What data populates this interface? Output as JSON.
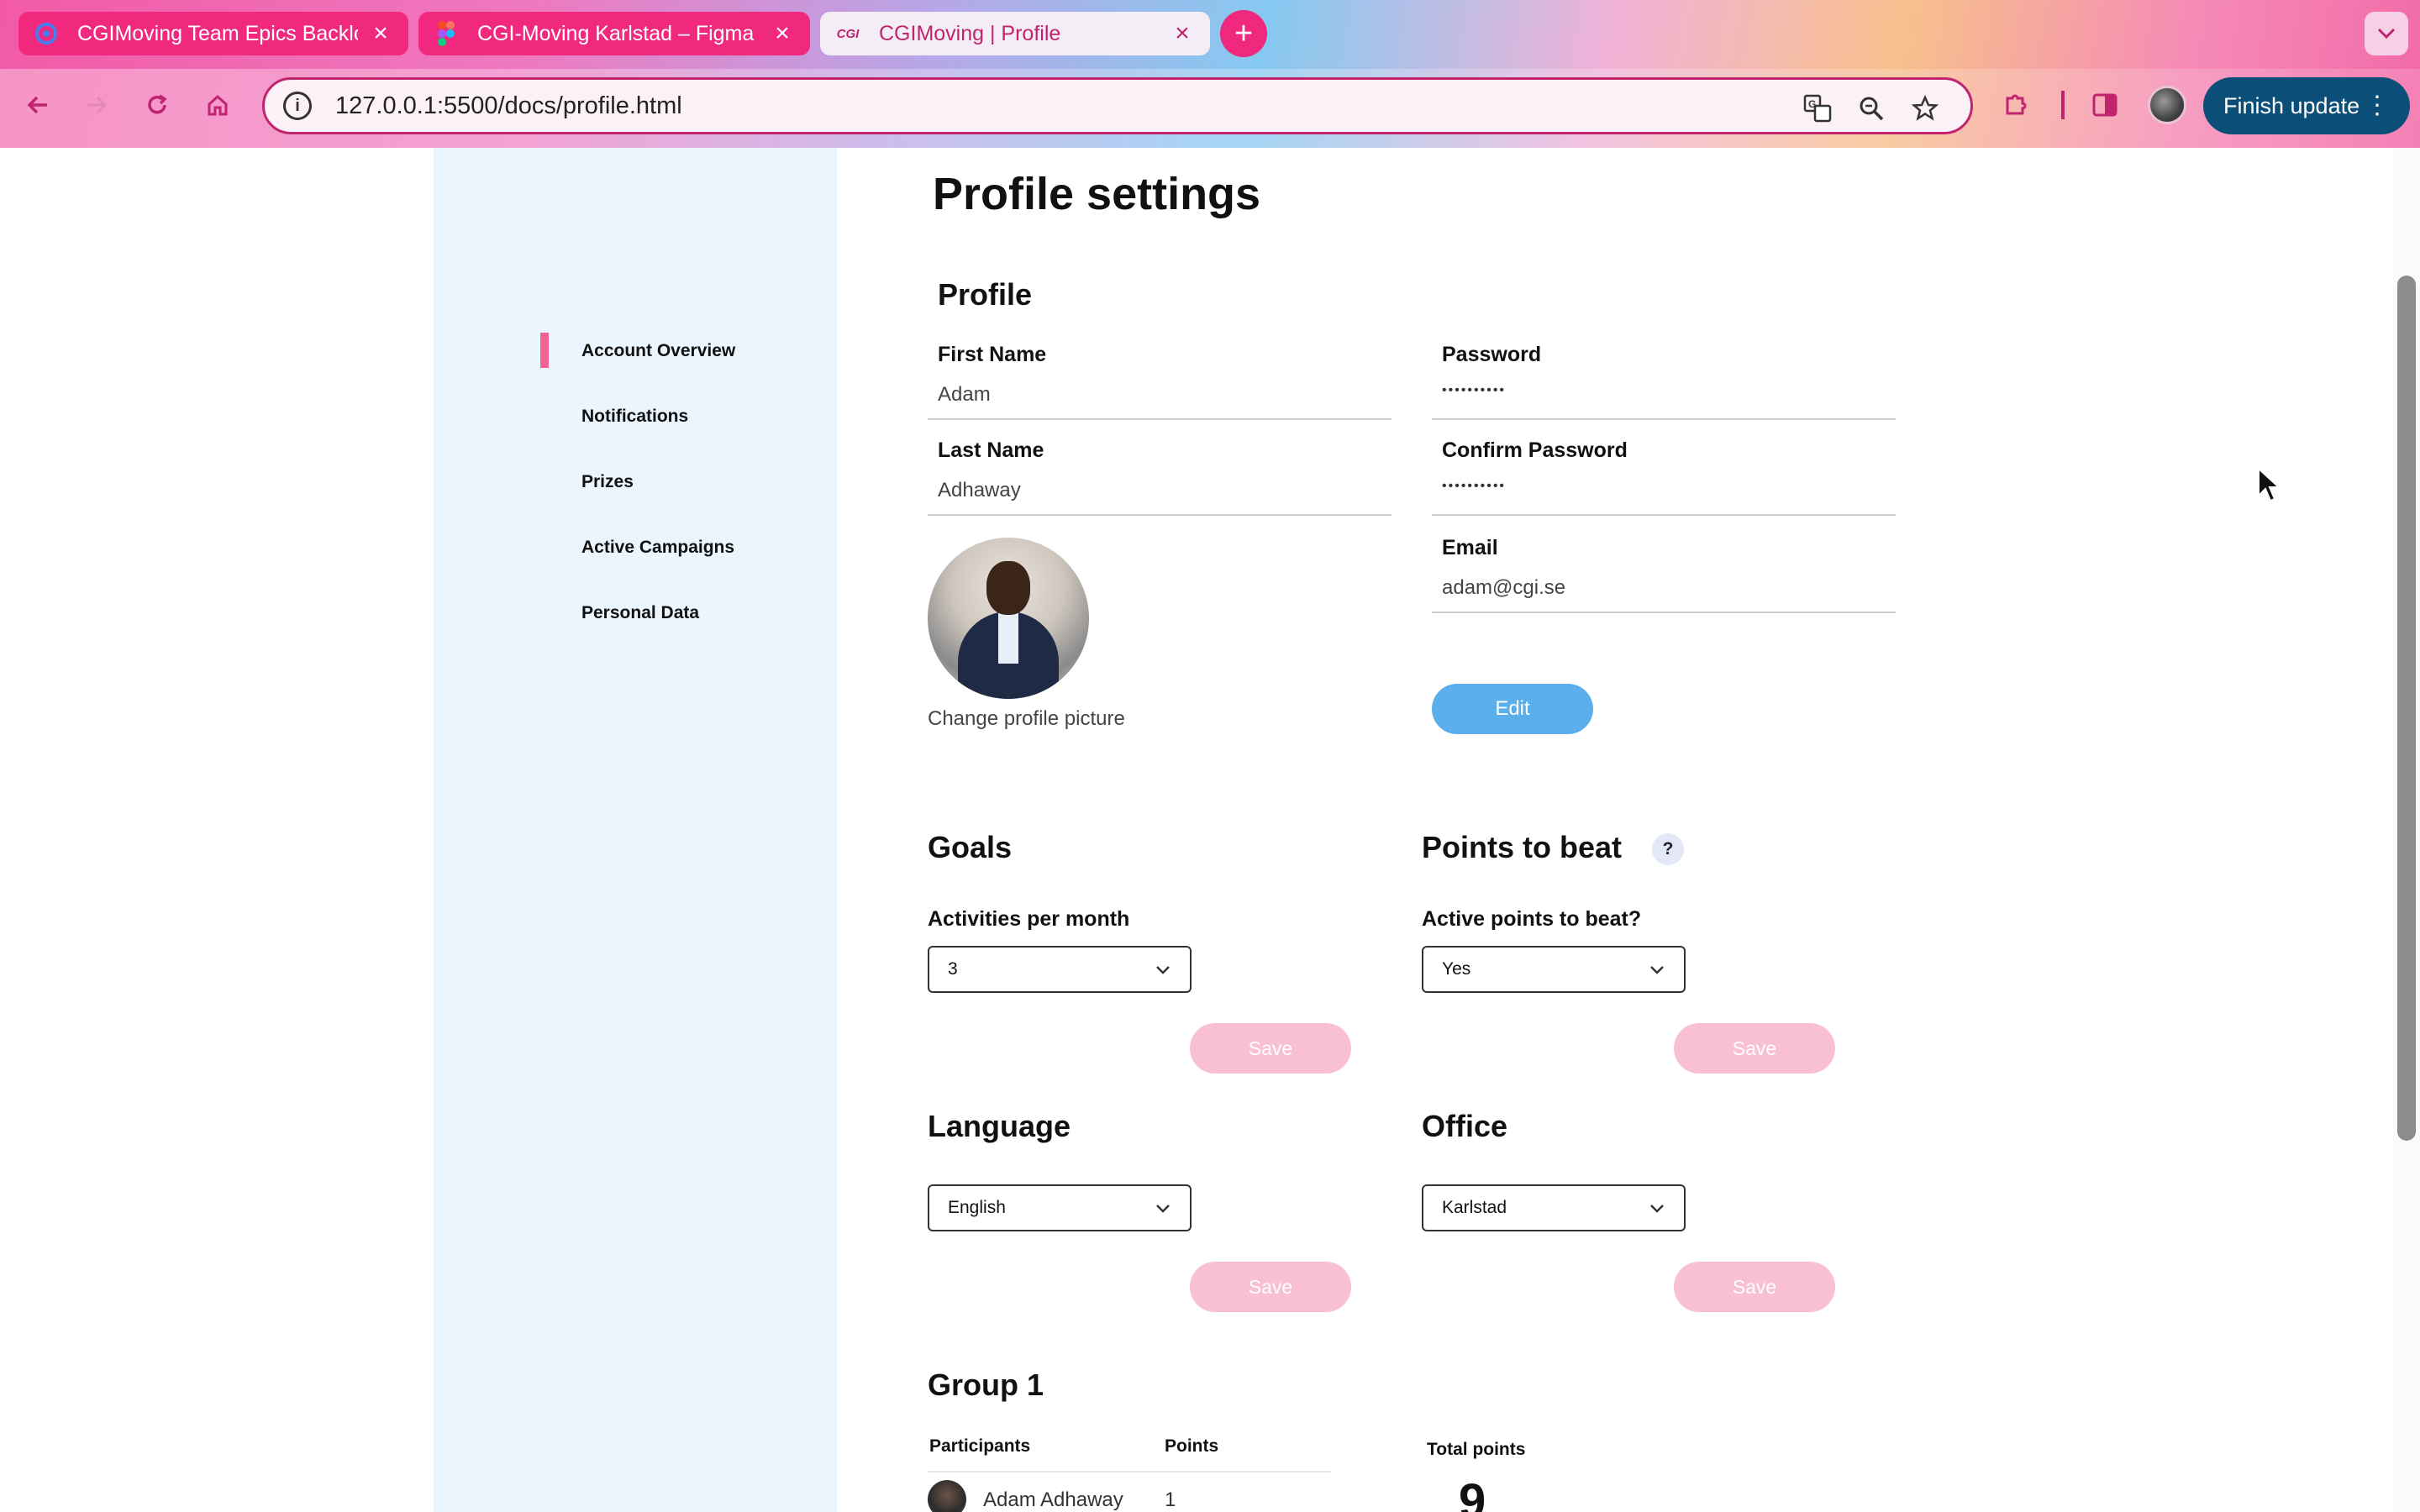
{
  "browser": {
    "tabs": [
      {
        "title": "CGIMoving Team Epics Backlog",
        "icon": "jira-icon"
      },
      {
        "title": "CGI-Moving Karlstad – Figma",
        "icon": "figma-icon"
      },
      {
        "title": "CGIMoving | Profile",
        "icon": "cgi-icon",
        "favicon_text": "CGI"
      }
    ],
    "url": "127.0.0.1:5500/docs/profile.html",
    "finish_update_label": "Finish update"
  },
  "sidebar": {
    "items": [
      {
        "label": "Account Overview",
        "active": true
      },
      {
        "label": "Notifications"
      },
      {
        "label": "Prizes"
      },
      {
        "label": "Active Campaigns"
      },
      {
        "label": "Personal Data"
      }
    ]
  },
  "page": {
    "title": "Profile settings"
  },
  "profile": {
    "section_title": "Profile",
    "first_name_label": "First Name",
    "first_name_value": "Adam",
    "last_name_label": "Last Name",
    "last_name_value": "Adhaway",
    "password_label": "Password",
    "password_value": "••••••••••",
    "confirm_password_label": "Confirm Password",
    "confirm_password_value": "••••••••••",
    "email_label": "Email",
    "email_value": "adam@cgi.se",
    "change_picture_label": "Change profile picture",
    "edit_label": "Edit"
  },
  "goals": {
    "title": "Goals",
    "field_label": "Activities per month",
    "selected": "3",
    "save_label": "Save"
  },
  "points_to_beat": {
    "title": "Points to beat",
    "help": "?",
    "field_label": "Active points to beat?",
    "selected": "Yes",
    "save_label": "Save"
  },
  "language": {
    "title": "Language",
    "selected": "English",
    "save_label": "Save"
  },
  "office": {
    "title": "Office",
    "selected": "Karlstad",
    "save_label": "Save"
  },
  "group": {
    "title": "Group 1",
    "columns": [
      "Participants",
      "Points"
    ],
    "rows": [
      {
        "name": "Adam Adhaway",
        "points": "1"
      }
    ],
    "total_label": "Total points",
    "total_value": "9"
  },
  "colors": {
    "accent_pink": "#f06292",
    "edit_blue": "#5aaeea",
    "save_disabled": "#f9bfd4",
    "sidebar_bg": "#eaf5fd"
  }
}
